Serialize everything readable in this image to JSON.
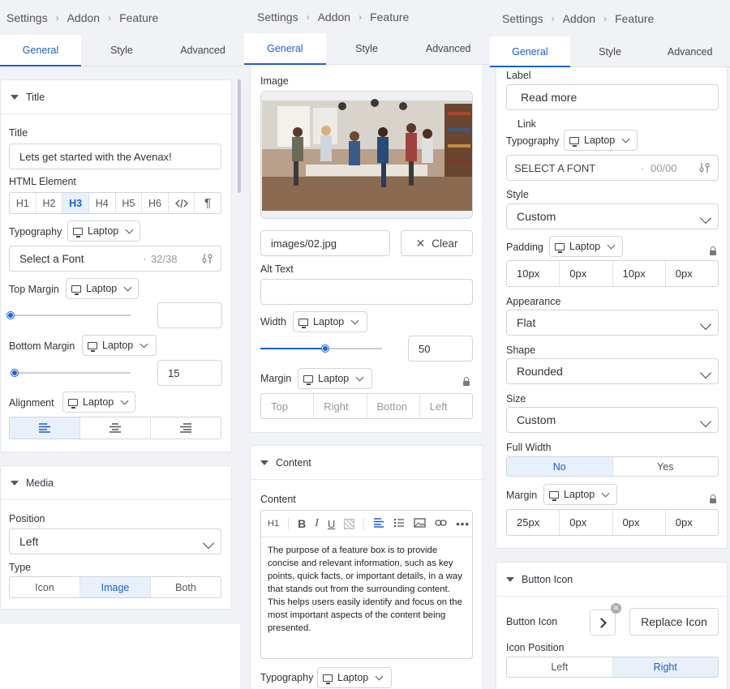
{
  "breadcrumb": [
    "Settings",
    "Addon",
    "Feature"
  ],
  "tabs": [
    "General",
    "Style",
    "Advanced"
  ],
  "col1": {
    "title_section": "Title",
    "title_label": "Title",
    "title_value": "Lets get started with the Avenax!",
    "html_element_label": "HTML Element",
    "html_buttons": [
      "H1",
      "H2",
      "H3",
      "H4",
      "H5",
      "H6"
    ],
    "typography_label": "Typography",
    "device": "Laptop",
    "font_placeholder": "Select a Font",
    "font_count": "32/38",
    "top_margin_label": "Top Margin",
    "top_margin_value": "",
    "bottom_margin_label": "Bottom Margin",
    "bottom_margin_value": "15",
    "alignment_label": "Alignment",
    "media_section": "Media",
    "position_label": "Position",
    "position_value": "Left",
    "type_label": "Type",
    "type_options": [
      "Icon",
      "Image",
      "Both"
    ]
  },
  "col2": {
    "image_label": "Image",
    "image_path": "images/02.jpg",
    "clear_label": "Clear",
    "alt_text_label": "Alt Text",
    "alt_text_value": "",
    "width_label": "Width",
    "device": "Laptop",
    "width_value": "50",
    "width_slider_fraction": 0.53,
    "margin_label": "Margin",
    "margin_placeholders": [
      "Top",
      "Right",
      "Botton",
      "Left"
    ],
    "content_section": "Content",
    "content_label": "Content",
    "content_text": "The purpose of a feature box is to provide concise and relevant information, such as key points, quick facts, or important details, in a way that stands out from the surrounding content. This helps users easily identify and focus on the most important aspects of the content being presented.",
    "typography_label": "Typography",
    "toolbar_heading": "H1"
  },
  "col3": {
    "label_label": "Label",
    "label_value": "Read more",
    "link_label": "Link",
    "typography_label": "Typography",
    "device": "Laptop",
    "font_placeholder": "SELECT A FONT",
    "font_count": "00/00",
    "style_label": "Style",
    "style_value": "Custom",
    "padding_label": "Padding",
    "padding_values": [
      "10px",
      "0px",
      "10px",
      "0px"
    ],
    "appearance_label": "Appearance",
    "appearance_value": "Flat",
    "shape_label": "Shape",
    "shape_value": "Rounded",
    "size_label": "Size",
    "size_value": "Custom",
    "full_width_label": "Full Width",
    "full_width_options": [
      "No",
      "Yes"
    ],
    "margin_label": "Margin",
    "margin_values": [
      "25px",
      "0px",
      "0px",
      "0px"
    ],
    "button_icon_section": "Button Icon",
    "button_icon_label": "Button Icon",
    "replace_icon_label": "Replace Icon",
    "icon_position_label": "Icon Position",
    "icon_position_options": [
      "Left",
      "Right"
    ]
  },
  "colors": {
    "accent": "#1a5fd0",
    "accent_bg": "#e8f0fc",
    "border": "#cfd4da"
  }
}
